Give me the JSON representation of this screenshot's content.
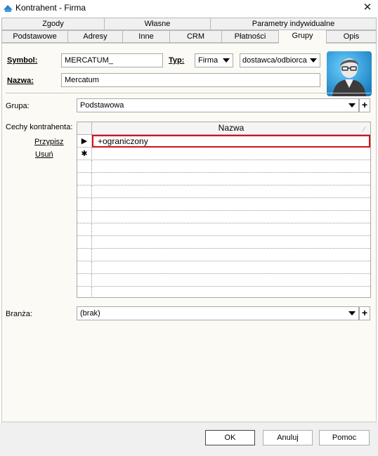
{
  "window": {
    "title": "Kontrahent - Firma",
    "close_glyph": "✕"
  },
  "tabs_row1": [
    {
      "label": "Zgody"
    },
    {
      "label": "Własne"
    },
    {
      "label": "Parametry indywidualne"
    }
  ],
  "tabs_row2": [
    {
      "label": "Podstawowe"
    },
    {
      "label": "Adresy"
    },
    {
      "label": "Inne"
    },
    {
      "label": "CRM"
    },
    {
      "label": "Płatności"
    },
    {
      "label": "Grupy",
      "active": true
    },
    {
      "label": "Opis"
    }
  ],
  "form": {
    "symbol_label": "Symbol:",
    "symbol_value": "MERCATUM_",
    "typ_label": "Typ:",
    "typ_value": "Firma",
    "rodzaj_value": "dostawca/odbiorca",
    "nazwa_label": "Nazwa:",
    "nazwa_value": "Mercatum",
    "grupa_label": "Grupa:",
    "grupa_value": "Podstawowa",
    "cechy_label": "Cechy kontrahenta:",
    "przypisz_label": "Przypisz",
    "usun_label": "Usuń",
    "branza_label": "Branża:",
    "branza_value": "(brak)",
    "plus_glyph": "+"
  },
  "grid": {
    "column": "Nazwa",
    "rows": [
      {
        "indicator": "▶",
        "value": "+ograniczony",
        "selected": true
      },
      {
        "indicator": "✱",
        "value": ""
      }
    ]
  },
  "buttons": {
    "ok": "OK",
    "cancel": "Anuluj",
    "help": "Pomoc"
  },
  "colors": {
    "panel_bg": "#fcfaf4",
    "selection_border": "#d2121b",
    "avatar_bg": "#2a9fd8"
  }
}
